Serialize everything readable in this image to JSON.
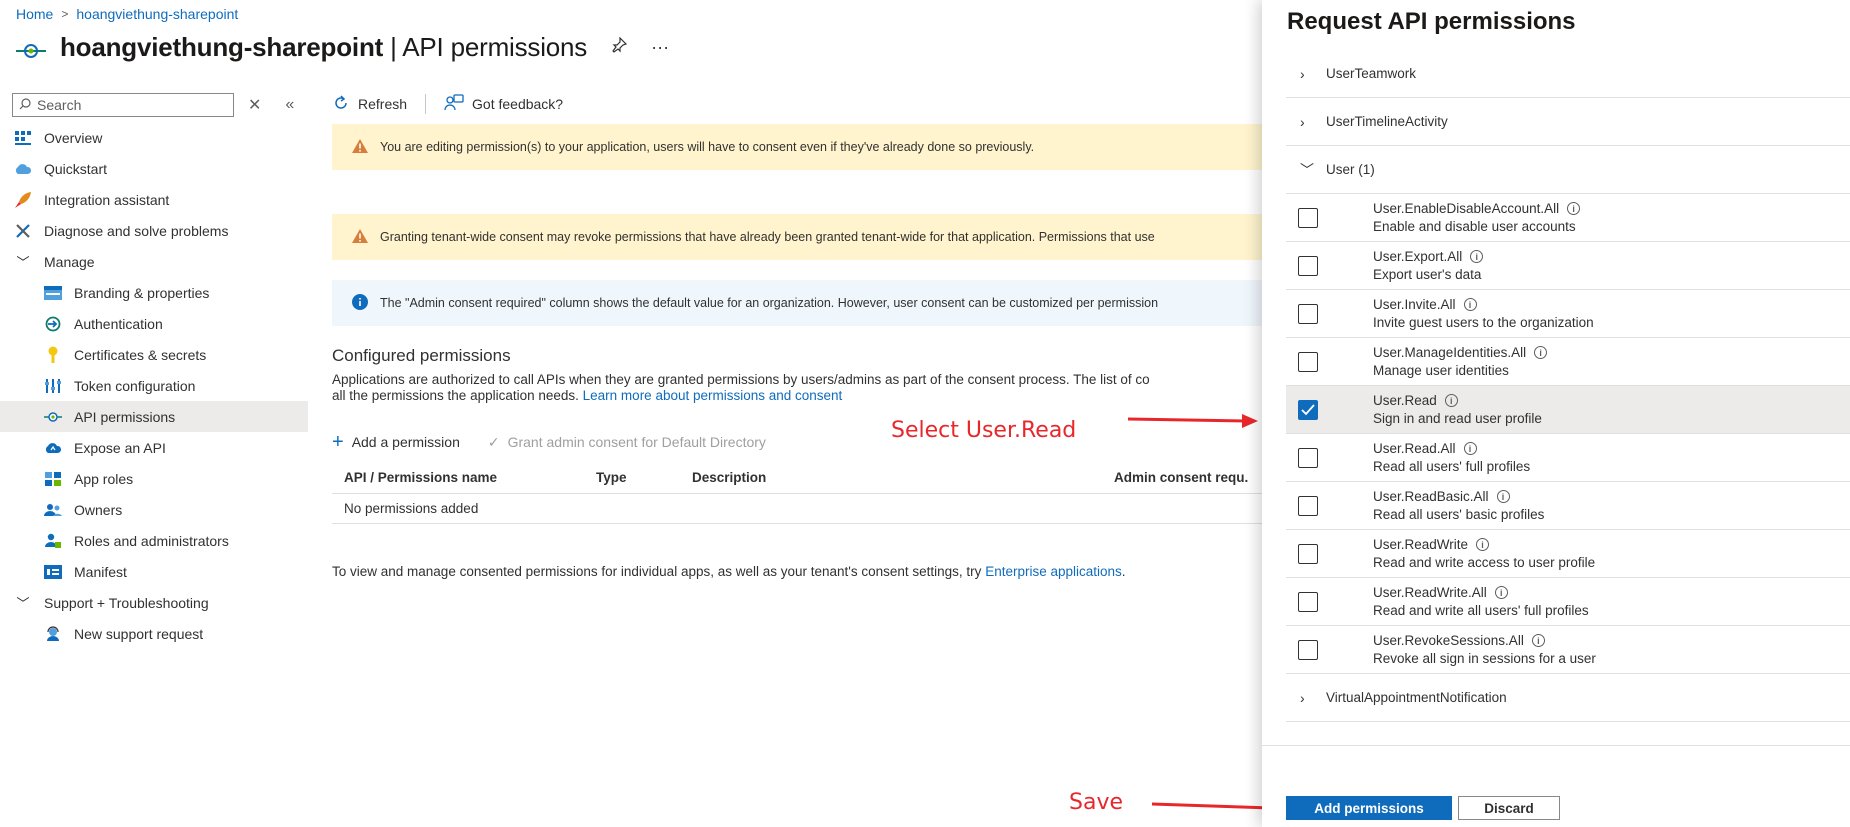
{
  "breadcrumb": {
    "home": "Home",
    "separator": ">",
    "current": "hoangviethung-sharepoint"
  },
  "header": {
    "app_name": "hoangviethung-sharepoint",
    "divider": " | ",
    "page_title": "API permissions",
    "pin_icon": "pin-icon",
    "more": "···"
  },
  "sidebar": {
    "search_placeholder": "Search",
    "items": [
      {
        "label": "Overview",
        "icon": "grid-icon"
      },
      {
        "label": "Quickstart",
        "icon": "cloud-icon"
      },
      {
        "label": "Integration assistant",
        "icon": "rocket-icon"
      },
      {
        "label": "Diagnose and solve problems",
        "icon": "wrench-icon"
      },
      {
        "label": "Manage",
        "icon": "chevron-down-icon"
      },
      {
        "label": "Branding & properties",
        "icon": "branding-icon"
      },
      {
        "label": "Authentication",
        "icon": "authentication-icon"
      },
      {
        "label": "Certificates & secrets",
        "icon": "key-icon"
      },
      {
        "label": "Token configuration",
        "icon": "bars-icon"
      },
      {
        "label": "API permissions",
        "icon": "api-icon"
      },
      {
        "label": "Expose an API",
        "icon": "cloud-icon"
      },
      {
        "label": "App roles",
        "icon": "grid-icon"
      },
      {
        "label": "Owners",
        "icon": "people-icon"
      },
      {
        "label": "Roles and administrators",
        "icon": "person-icon"
      },
      {
        "label": "Manifest",
        "icon": "manifest-icon"
      },
      {
        "label": "Support + Troubleshooting",
        "icon": "chevron-down-icon"
      },
      {
        "label": "New support request",
        "icon": "support-icon"
      }
    ]
  },
  "toolbar": {
    "refresh": "Refresh",
    "feedback": "Got feedback?"
  },
  "banners": {
    "editing": "You are editing permission(s) to your application, users will have to consent even if they've already done so previously.",
    "granting": "Granting tenant-wide consent may revoke permissions that have already been granted tenant-wide for that application. Permissions that use",
    "info": "The \"Admin consent required\" column shows the default value for an organization. However, user consent can be customized per permission"
  },
  "configured": {
    "title": "Configured permissions",
    "desc_line1": "Applications are authorized to call APIs when they are granted permissions by users/admins as part of the consent process. The list of co",
    "desc_line2_prefix": "all the permissions the application needs. ",
    "learn_more": "Learn more about permissions and consent",
    "add_permission": "Add a permission",
    "grant_consent": "Grant admin consent for Default Directory",
    "columns": {
      "name": "API / Permissions name",
      "type": "Type",
      "description": "Description",
      "admin": "Admin consent requ."
    },
    "empty_row": "No permissions added",
    "footnote_prefix": "To view and manage consented permissions for individual apps, as well as your tenant's consent settings, try ",
    "footnote_link": "Enterprise applications",
    "footnote_suffix": "."
  },
  "panel": {
    "title": "Request API permissions",
    "groups_top": [
      "UserTeamwork",
      "UserTimelineActivity"
    ],
    "user_group": "User (1)",
    "permissions": [
      {
        "name": "User.EnableDisableAccount.All",
        "desc": "Enable and disable user accounts",
        "checked": false
      },
      {
        "name": "User.Export.All",
        "desc": "Export user's data",
        "checked": false
      },
      {
        "name": "User.Invite.All",
        "desc": "Invite guest users to the organization",
        "checked": false
      },
      {
        "name": "User.ManageIdentities.All",
        "desc": "Manage user identities",
        "checked": false
      },
      {
        "name": "User.Read",
        "desc": "Sign in and read user profile",
        "checked": true
      },
      {
        "name": "User.Read.All",
        "desc": "Read all users' full profiles",
        "checked": false
      },
      {
        "name": "User.ReadBasic.All",
        "desc": "Read all users' basic profiles",
        "checked": false
      },
      {
        "name": "User.ReadWrite",
        "desc": "Read and write access to user profile",
        "checked": false
      },
      {
        "name": "User.ReadWrite.All",
        "desc": "Read and write all users' full profiles",
        "checked": false
      },
      {
        "name": "User.RevokeSessions.All",
        "desc": "Revoke all sign in sessions for a user",
        "checked": false
      }
    ],
    "groups_bottom": [
      "VirtualAppointmentNotification"
    ],
    "add_button": "Add permissions",
    "discard_button": "Discard"
  },
  "annotations": {
    "select": "Select User.Read",
    "save": "Save",
    "color": "#e8272b"
  },
  "colors": {
    "accent": "#0f6cbd",
    "warning_bg": "#fff4ce",
    "info_bg": "#eff6fc",
    "warning_icon": "#d67f3c"
  }
}
